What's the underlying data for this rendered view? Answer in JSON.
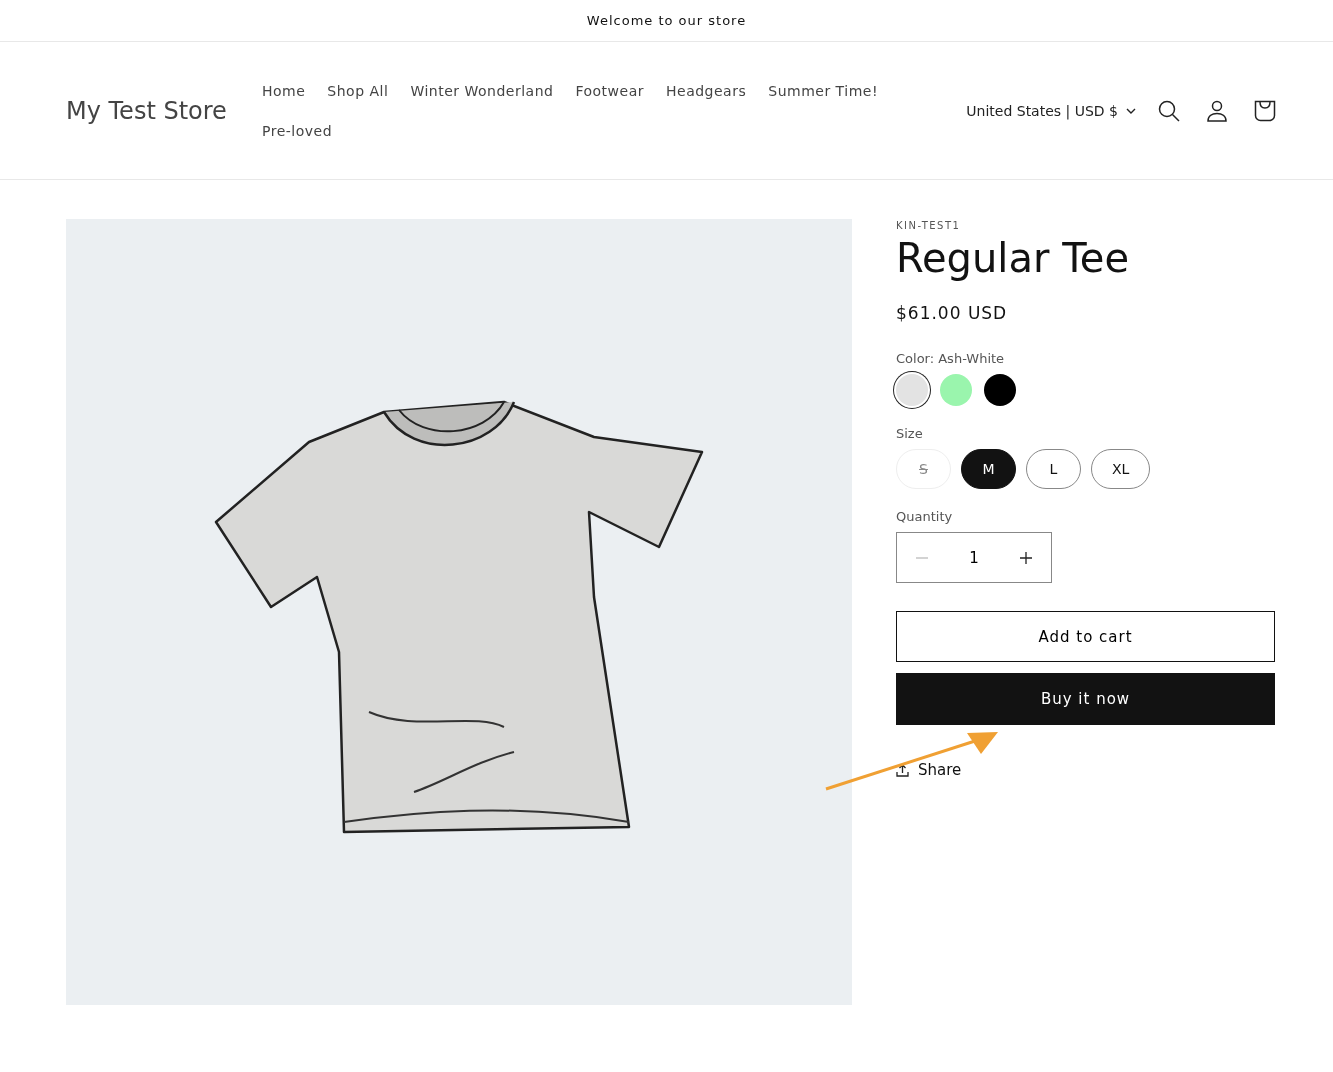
{
  "announcement": "Welcome to our store",
  "header": {
    "logo": "My Test Store",
    "nav": [
      {
        "label": "Home"
      },
      {
        "label": "Shop All"
      },
      {
        "label": "Winter Wonderland"
      },
      {
        "label": "Footwear"
      },
      {
        "label": "Headgears"
      },
      {
        "label": "Summer Time!"
      },
      {
        "label": "Pre-loved"
      }
    ],
    "country": "United States | USD $"
  },
  "product": {
    "vendor": "KIN-TEST1",
    "title": "Regular Tee",
    "price": "$61.00 USD",
    "color_label": "Color: Ash-White",
    "colors": [
      {
        "selected": true,
        "color": "#e3e3e3"
      },
      {
        "selected": false,
        "color": "#9af5ad"
      },
      {
        "selected": false,
        "color": "#000000"
      }
    ],
    "size_label": "Size",
    "sizes": [
      {
        "label": "S",
        "selected": false,
        "disabled": true
      },
      {
        "label": "M",
        "selected": true,
        "disabled": false
      },
      {
        "label": "L",
        "selected": false,
        "disabled": false
      },
      {
        "label": "XL",
        "selected": false,
        "disabled": false
      }
    ],
    "quantity_label": "Quantity",
    "quantity": "1",
    "minus_disabled": true,
    "add_to_cart": "Add to cart",
    "buy_now": "Buy it now",
    "share": "Share"
  },
  "annotation": {
    "kind": "arrow"
  }
}
